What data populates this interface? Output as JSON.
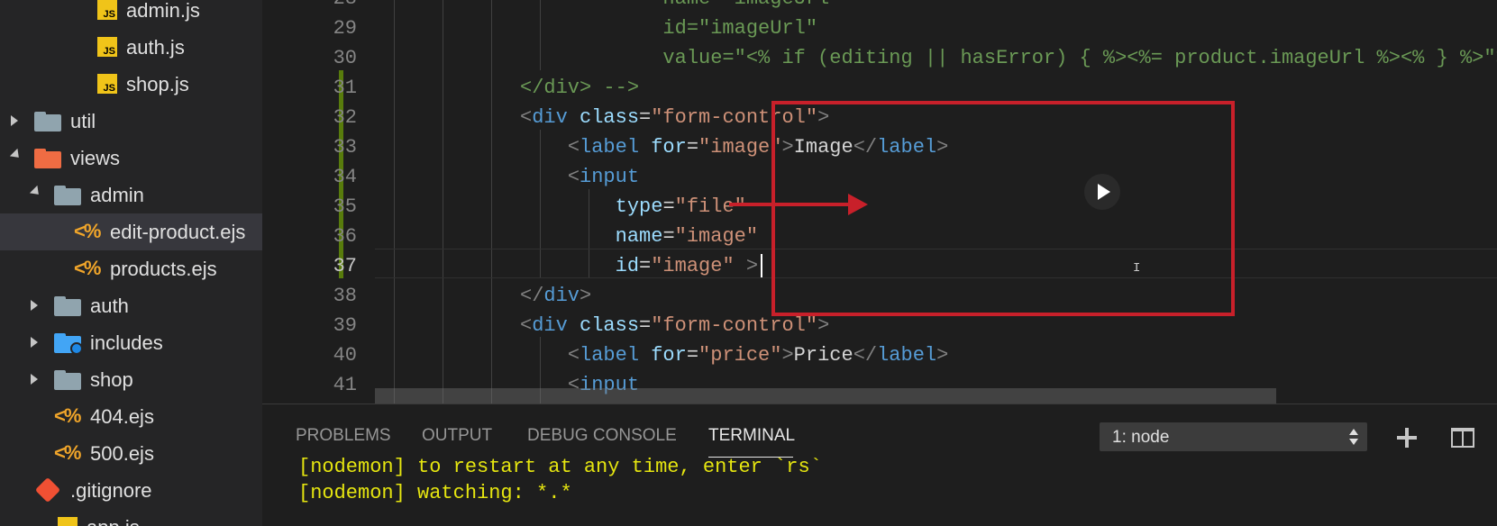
{
  "sidebar": {
    "items": [
      {
        "label": "admin.js",
        "type": "js",
        "depth": 3,
        "icon": "js-file-icon"
      },
      {
        "label": "auth.js",
        "type": "js",
        "depth": 3,
        "icon": "js-file-icon"
      },
      {
        "label": "shop.js",
        "type": "js",
        "depth": 3,
        "icon": "js-file-icon"
      },
      {
        "label": "util",
        "type": "folder",
        "state": "collapsed",
        "depth": 1,
        "icon": "folder-icon"
      },
      {
        "label": "views",
        "type": "folder-views",
        "state": "expanded",
        "depth": 1,
        "icon": "views-folder-icon"
      },
      {
        "label": "admin",
        "type": "folder",
        "state": "expanded",
        "depth": 2,
        "icon": "folder-open-icon"
      },
      {
        "label": "edit-product.ejs",
        "type": "ejs",
        "depth": 3,
        "selected": true,
        "icon": "ejs-file-icon"
      },
      {
        "label": "products.ejs",
        "type": "ejs",
        "depth": 3,
        "icon": "ejs-file-icon"
      },
      {
        "label": "auth",
        "type": "folder",
        "state": "collapsed",
        "depth": 2,
        "icon": "folder-icon"
      },
      {
        "label": "includes",
        "type": "folder-includes",
        "state": "collapsed",
        "depth": 2,
        "icon": "includes-folder-icon"
      },
      {
        "label": "shop",
        "type": "folder",
        "state": "collapsed",
        "depth": 2,
        "icon": "folder-icon"
      },
      {
        "label": "404.ejs",
        "type": "ejs",
        "depth": 2,
        "icon": "ejs-file-icon"
      },
      {
        "label": "500.ejs",
        "type": "ejs",
        "depth": 2,
        "icon": "ejs-file-icon"
      },
      {
        "label": ".gitignore",
        "type": "git",
        "depth": 1,
        "icon": "git-icon"
      },
      {
        "label": "app.js",
        "type": "js",
        "depth": 1,
        "icon": "js-file-icon"
      }
    ]
  },
  "editor": {
    "active_line": "37",
    "lines": [
      {
        "num": "28",
        "tokens": [
          {
            "t": "            name=\"imageUrl\"",
            "c": "com"
          }
        ]
      },
      {
        "num": "29",
        "tokens": [
          {
            "t": "            id=\"imageUrl\"",
            "c": "com"
          }
        ]
      },
      {
        "num": "30",
        "tokens": [
          {
            "t": "            value=\"<% if (editing || hasError) { %><%= product.imageUrl %><% } %>\">",
            "c": "com"
          }
        ]
      },
      {
        "num": "31",
        "tokens": [
          {
            "t": "</div> -->",
            "c": "com"
          }
        ]
      },
      {
        "num": "32",
        "tokens": [
          {
            "t": "<",
            "c": "punct"
          },
          {
            "t": "div",
            "c": "tag"
          },
          {
            "t": " ",
            "c": "txt"
          },
          {
            "t": "class",
            "c": "attr"
          },
          {
            "t": "=",
            "c": "txt"
          },
          {
            "t": "\"form-control\"",
            "c": "str"
          },
          {
            "t": ">",
            "c": "punct"
          }
        ]
      },
      {
        "num": "33",
        "tokens": [
          {
            "t": "    ",
            "c": "txt"
          },
          {
            "t": "<",
            "c": "punct"
          },
          {
            "t": "label",
            "c": "tag"
          },
          {
            "t": " ",
            "c": "txt"
          },
          {
            "t": "for",
            "c": "attr"
          },
          {
            "t": "=",
            "c": "txt"
          },
          {
            "t": "\"image\"",
            "c": "str"
          },
          {
            "t": ">",
            "c": "punct"
          },
          {
            "t": "Image",
            "c": "txt"
          },
          {
            "t": "</",
            "c": "punct"
          },
          {
            "t": "label",
            "c": "tag"
          },
          {
            "t": ">",
            "c": "punct"
          }
        ]
      },
      {
        "num": "34",
        "tokens": [
          {
            "t": "    ",
            "c": "txt"
          },
          {
            "t": "<",
            "c": "punct"
          },
          {
            "t": "input",
            "c": "tag"
          }
        ]
      },
      {
        "num": "35",
        "tokens": [
          {
            "t": "        ",
            "c": "txt"
          },
          {
            "t": "type",
            "c": "attr"
          },
          {
            "t": "=",
            "c": "txt"
          },
          {
            "t": "\"file\"",
            "c": "str"
          }
        ]
      },
      {
        "num": "36",
        "tokens": [
          {
            "t": "        ",
            "c": "txt"
          },
          {
            "t": "name",
            "c": "attr"
          },
          {
            "t": "=",
            "c": "txt"
          },
          {
            "t": "\"image\"",
            "c": "str"
          }
        ]
      },
      {
        "num": "37",
        "tokens": [
          {
            "t": "        ",
            "c": "txt"
          },
          {
            "t": "id",
            "c": "attr"
          },
          {
            "t": "=",
            "c": "txt"
          },
          {
            "t": "\"image\"",
            "c": "str"
          },
          {
            "t": " >",
            "c": "punct"
          }
        ]
      },
      {
        "num": "38",
        "tokens": [
          {
            "t": "</",
            "c": "punct"
          },
          {
            "t": "div",
            "c": "tag"
          },
          {
            "t": ">",
            "c": "punct"
          }
        ]
      },
      {
        "num": "39",
        "tokens": [
          {
            "t": "<",
            "c": "punct"
          },
          {
            "t": "div",
            "c": "tag"
          },
          {
            "t": " ",
            "c": "txt"
          },
          {
            "t": "class",
            "c": "attr"
          },
          {
            "t": "=",
            "c": "txt"
          },
          {
            "t": "\"form-control\"",
            "c": "str"
          },
          {
            "t": ">",
            "c": "punct"
          }
        ]
      },
      {
        "num": "40",
        "tokens": [
          {
            "t": "    ",
            "c": "txt"
          },
          {
            "t": "<",
            "c": "punct"
          },
          {
            "t": "label",
            "c": "tag"
          },
          {
            "t": " ",
            "c": "txt"
          },
          {
            "t": "for",
            "c": "attr"
          },
          {
            "t": "=",
            "c": "txt"
          },
          {
            "t": "\"price\"",
            "c": "str"
          },
          {
            "t": ">",
            "c": "punct"
          },
          {
            "t": "Price",
            "c": "txt"
          },
          {
            "t": "</",
            "c": "punct"
          },
          {
            "t": "label",
            "c": "tag"
          },
          {
            "t": ">",
            "c": "punct"
          }
        ]
      },
      {
        "num": "41",
        "tokens": [
          {
            "t": "    ",
            "c": "txt"
          },
          {
            "t": "<",
            "c": "punct"
          },
          {
            "t": "input",
            "c": "tag"
          }
        ]
      }
    ]
  },
  "panel": {
    "tabs": [
      {
        "label": "PROBLEMS"
      },
      {
        "label": "OUTPUT"
      },
      {
        "label": "DEBUG CONSOLE"
      },
      {
        "label": "TERMINAL",
        "active": true
      }
    ],
    "terminal_selector": "1: node",
    "terminal_lines": [
      "[nodemon] to restart at any time, enter `rs`",
      "[nodemon] watching: *.*"
    ]
  },
  "colors": {
    "annotation": "#c8202a",
    "gutter_modified": "#587c0c",
    "terminal_text": "#e5e510"
  }
}
